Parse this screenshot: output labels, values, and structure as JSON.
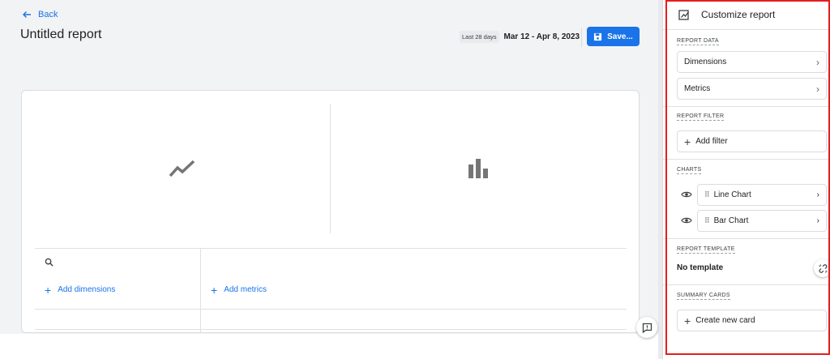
{
  "header": {
    "back_label": "Back",
    "title": "Untitled report",
    "date_chip": "Last 28 days",
    "date_range": "Mar 12 - Apr 8, 2023",
    "save_label": "Save..."
  },
  "table": {
    "add_dimensions_label": "Add dimensions",
    "add_metrics_label": "Add metrics"
  },
  "panel": {
    "title": "Customize report",
    "report_data_label": "REPORT DATA",
    "dimensions_label": "Dimensions",
    "metrics_label": "Metrics",
    "report_filter_label": "REPORT FILTER",
    "add_filter_label": "Add filter",
    "charts_label": "CHARTS",
    "charts": [
      {
        "label": "Line Chart"
      },
      {
        "label": "Bar Chart"
      }
    ],
    "report_template_label": "REPORT TEMPLATE",
    "no_template_label": "No template",
    "summary_cards_label": "SUMMARY CARDS",
    "create_card_label": "Create new card"
  },
  "colors": {
    "accent": "#1a73e8",
    "highlight": "#e41e1e",
    "icon_gray": "#757575"
  }
}
